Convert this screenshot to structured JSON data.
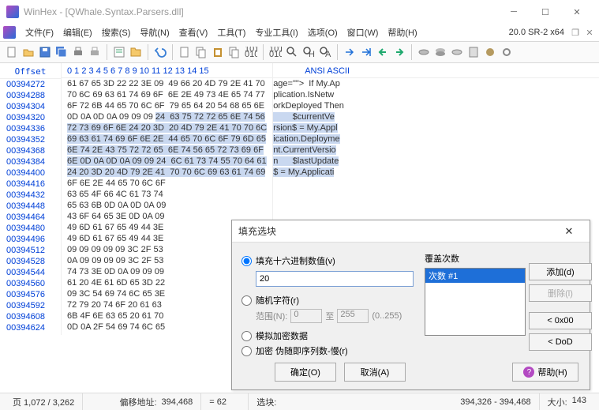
{
  "window": {
    "title": "WinHex - [QWhale.Syntax.Parsers.dll]",
    "version": "20.0 SR-2 x64"
  },
  "menu": [
    "文件(F)",
    "编辑(E)",
    "搜索(S)",
    "导航(N)",
    "查看(V)",
    "工具(T)",
    "专业工具(I)",
    "选项(O)",
    "窗口(W)",
    "帮助(H)"
  ],
  "hex": {
    "offset_header": "Offset",
    "bytes_header": " 0  1  2  3  4  5  6  7   8  9 10 11 12 13 14 15",
    "ascii_header": "ANSI ASCII",
    "rows": [
      {
        "off": "00394272",
        "b": "61 67 65 3D 22 22 3E 09  49 66 20 4D 79 2E 41 70",
        "a": "age=\"\">  If My.Ap"
      },
      {
        "off": "00394288",
        "b": "70 6C 69 63 61 74 69 6F  6E 2E 49 73 4E 65 74 77",
        "a": "plication.IsNetw"
      },
      {
        "off": "00394304",
        "b": "6F 72 6B 44 65 70 6C 6F  79 65 64 20 54 68 65 6E",
        "a": "orkDeployed Then"
      },
      {
        "off": "00394320",
        "b": "0D 0A 0D 0A 09 09 09 24  63 75 72 72 65 6E 74 56",
        "a": "        $currentVe"
      },
      {
        "off": "00394336",
        "b": "72 73 69 6F 6E 24 20 3D  20 4D 79 2E 41 70 70 6C",
        "a": "rsion$ = My.Appl"
      },
      {
        "off": "00394352",
        "b": "69 63 61 74 69 6F 6E 2E  44 65 70 6C 6F 79 6D 65",
        "a": "ication.Deployme"
      },
      {
        "off": "00394368",
        "b": "6E 74 2E 43 75 72 72 65  6E 74 56 65 72 73 69 6F",
        "a": "nt.CurrentVersio"
      },
      {
        "off": "00394384",
        "b": "6E 0D 0A 0D 0A 09 09 24  6C 61 73 74 55 70 64 61",
        "a": "n      $lastUpdate"
      },
      {
        "off": "00394400",
        "b": "24 20 3D 20 4D 79 2E 41  70 70 6C 69 63 61 74 69",
        "a": "$ = My.Applicati"
      },
      {
        "off": "00394416",
        "b": "6F 6E 2E 44 65 70 6C 6F",
        "a": ""
      },
      {
        "off": "00394432",
        "b": "63 65 4F 66 4C 61 73 74",
        "a": ""
      },
      {
        "off": "00394448",
        "b": "65 63 6B 0D 0A 0D 0A 09",
        "a": ""
      },
      {
        "off": "00394464",
        "b": "43 6F 64 65 3E 0D 0A 09",
        "a": ""
      },
      {
        "off": "00394480",
        "b": "49 6D 61 67 65 49 44 3E",
        "a": ""
      },
      {
        "off": "00394496",
        "b": "49 6D 61 67 65 49 44 3E",
        "a": ""
      },
      {
        "off": "00394512",
        "b": "09 09 09 09 09 3C 2F 53",
        "a": ""
      },
      {
        "off": "00394528",
        "b": "0A 09 09 09 09 3C 2F 53",
        "a": ""
      },
      {
        "off": "00394544",
        "b": "74 73 3E 0D 0A 09 09 09",
        "a": ""
      },
      {
        "off": "00394560",
        "b": "61 20 4E 61 6D 65 3D 22",
        "a": ""
      },
      {
        "off": "00394576",
        "b": "09 3C 54 69 74 6C 65 3E",
        "a": ""
      },
      {
        "off": "00394592",
        "b": "72 79 20 74 6F 20 61 63",
        "a": ""
      },
      {
        "off": "00394608",
        "b": "6B 4F 6E 63 65 20 61 70",
        "a": ""
      },
      {
        "off": "00394624",
        "b": "0D 0A 2F 54 69 74 6C 65",
        "a": ""
      }
    ],
    "sel_row": 3,
    "sel_start": 7
  },
  "dialog": {
    "title": "填充选块",
    "opt_hex": "填充十六进制数值(v)",
    "hex_value": "20",
    "opt_rand": "随机字符(r)",
    "range_label": "范围(N):",
    "range_from": "0",
    "range_to_label": "至",
    "range_to": "255",
    "range_hint": "(0..255)",
    "opt_enc": "模拟加密数据",
    "opt_enc2": "加密 伪随即序列数-慢(r)",
    "overwrite_label": "覆盖次数",
    "list_item": "次数 #1",
    "btn_add": "添加(d)",
    "btn_del": "删除(l)",
    "btn_0x00": "< 0x00",
    "btn_dod": "< DoD",
    "btn_ok": "确定(O)",
    "btn_cancel": "取消(A)",
    "btn_help": "帮助(H)"
  },
  "status": {
    "page": "页 1,072 / 3,262",
    "offlabel": "偏移地址:",
    "off": "394,468",
    "eqlabel": "= 62",
    "sellabel": "选块:",
    "sel": "394,326 - 394,468",
    "sizelabel": "大小:",
    "size": "143"
  }
}
